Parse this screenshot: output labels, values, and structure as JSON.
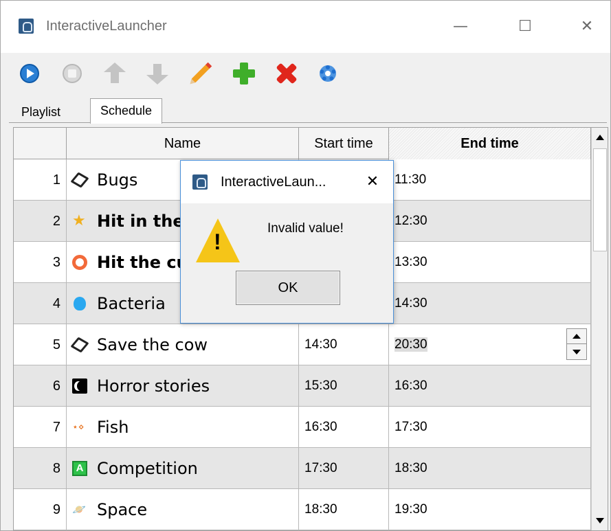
{
  "window": {
    "title": "InteractiveLauncher",
    "controls": {
      "minimize": "—",
      "maximize": "☐",
      "close": "✕"
    }
  },
  "toolbar": {
    "buttons": [
      {
        "name": "play",
        "icon": "play-icon"
      },
      {
        "name": "stop",
        "icon": "stop-icon"
      },
      {
        "name": "move-up",
        "icon": "arrow-up-icon"
      },
      {
        "name": "move-down",
        "icon": "arrow-down-icon"
      },
      {
        "name": "edit",
        "icon": "pencil-icon"
      },
      {
        "name": "add",
        "icon": "plus-icon"
      },
      {
        "name": "delete",
        "icon": "delete-x-icon"
      },
      {
        "name": "settings",
        "icon": "gear-icon"
      }
    ]
  },
  "tabs": [
    {
      "label": "Playlist",
      "active": false
    },
    {
      "label": "Schedule",
      "active": true
    }
  ],
  "table": {
    "columns": {
      "number": "",
      "name": "Name",
      "start": "Start time",
      "end": "End time"
    },
    "rows": [
      {
        "num": "1",
        "name": "Bugs",
        "icon": "unity-icon",
        "start": "",
        "end": "11:30"
      },
      {
        "num": "2",
        "name": "Hit in the",
        "icon": "star-icon",
        "start": "",
        "end": "12:30"
      },
      {
        "num": "3",
        "name": "Hit the cu",
        "icon": "ring-icon",
        "start": "",
        "end": "13:30"
      },
      {
        "num": "4",
        "name": "Bacteria",
        "icon": "blob-icon",
        "start": "",
        "end": "14:30"
      },
      {
        "num": "5",
        "name": "Save the cow",
        "icon": "unity-icon",
        "start": "14:30",
        "end": "20:30"
      },
      {
        "num": "6",
        "name": "Horror stories",
        "icon": "moon-icon",
        "start": "15:30",
        "end": "16:30"
      },
      {
        "num": "7",
        "name": "Fish",
        "icon": "fish-icon",
        "start": "16:30",
        "end": "17:30"
      },
      {
        "num": "8",
        "name": "Competition",
        "icon": "competition-icon",
        "start": "17:30",
        "end": "18:30"
      },
      {
        "num": "9",
        "name": "Space",
        "icon": "planet-icon",
        "start": "18:30",
        "end": "19:30"
      }
    ]
  },
  "dialog": {
    "title": "InteractiveLaun...",
    "close": "✕",
    "message": "Invalid value!",
    "icon": "warning-icon",
    "warning_mark": "!",
    "ok_label": "OK"
  },
  "colors": {
    "accent": "#4a90d9",
    "row_alt": "#e6e6e6",
    "warning": "#f5c518"
  }
}
